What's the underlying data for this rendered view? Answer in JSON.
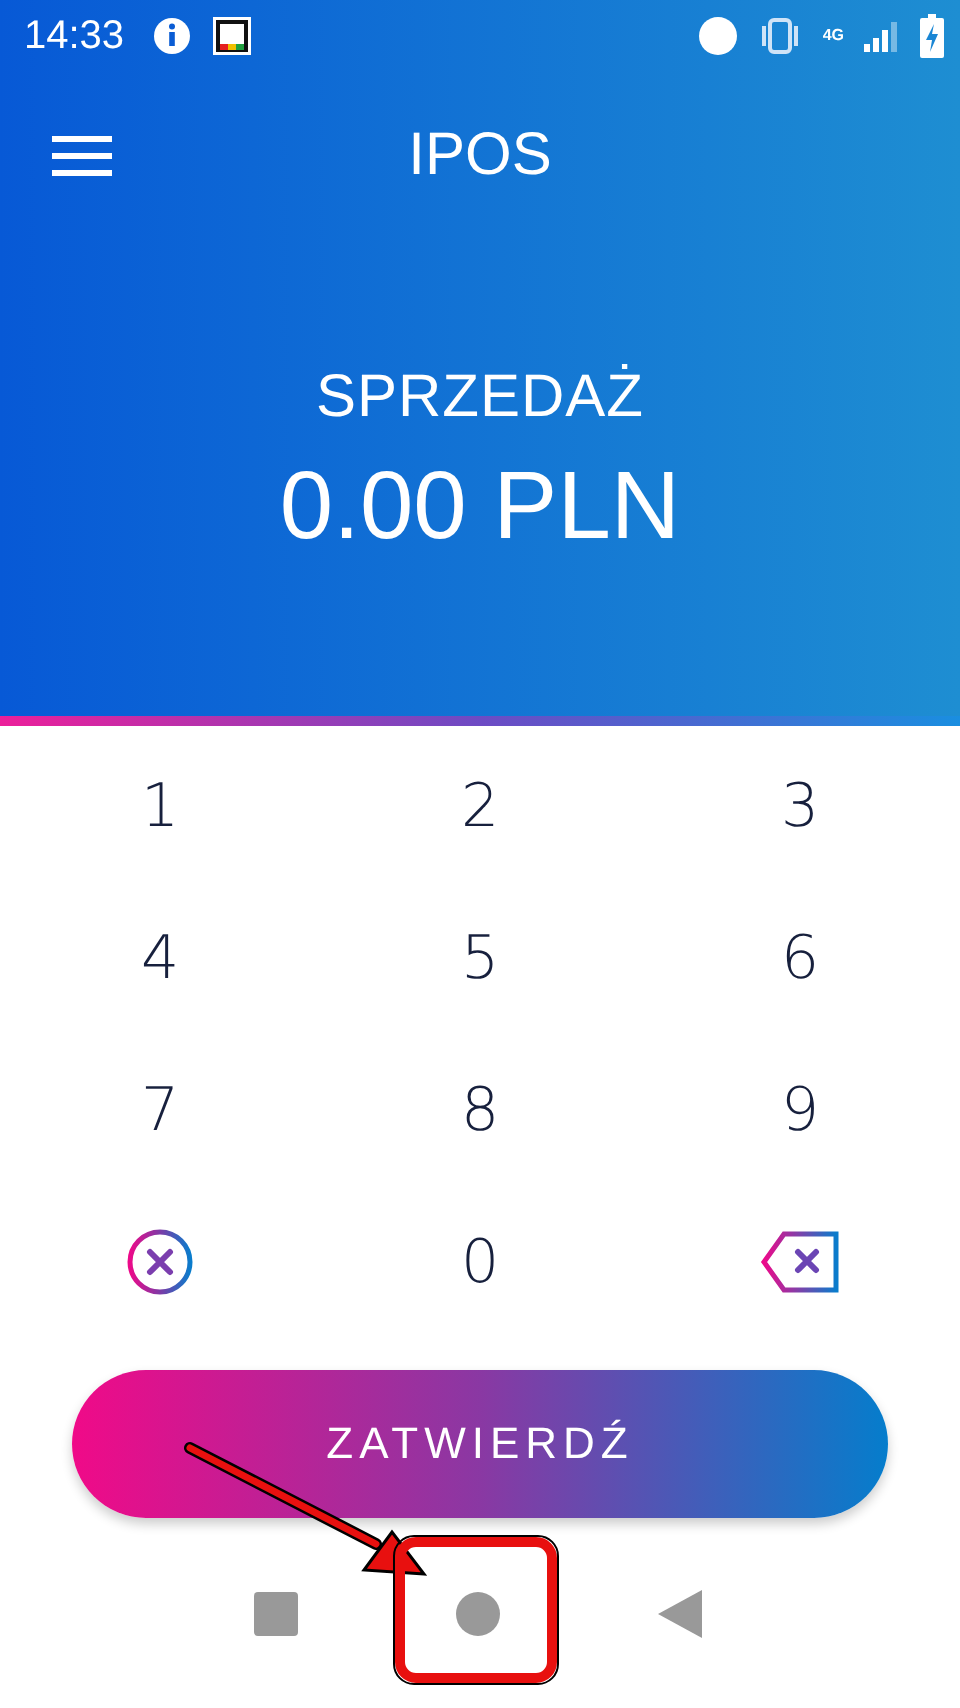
{
  "status_bar": {
    "time": "14:33",
    "network": "4G"
  },
  "header": {
    "title": "IPOS"
  },
  "sale": {
    "label": "SPRZEDAŻ",
    "amount": "0.00 PLN"
  },
  "keypad": [
    {
      "kind": "digit",
      "label": "1"
    },
    {
      "kind": "digit",
      "label": "2"
    },
    {
      "kind": "digit",
      "label": "3"
    },
    {
      "kind": "digit",
      "label": "4"
    },
    {
      "kind": "digit",
      "label": "5"
    },
    {
      "kind": "digit",
      "label": "6"
    },
    {
      "kind": "digit",
      "label": "7"
    },
    {
      "kind": "digit",
      "label": "8"
    },
    {
      "kind": "digit",
      "label": "9"
    },
    {
      "kind": "clear"
    },
    {
      "kind": "digit",
      "label": "0"
    },
    {
      "kind": "backspace"
    }
  ],
  "confirm_button": {
    "label": "ZATWIERDŹ"
  },
  "nav_bar": [
    {
      "kind": "recents"
    },
    {
      "kind": "home",
      "highlighted": true
    },
    {
      "kind": "back"
    }
  ]
}
